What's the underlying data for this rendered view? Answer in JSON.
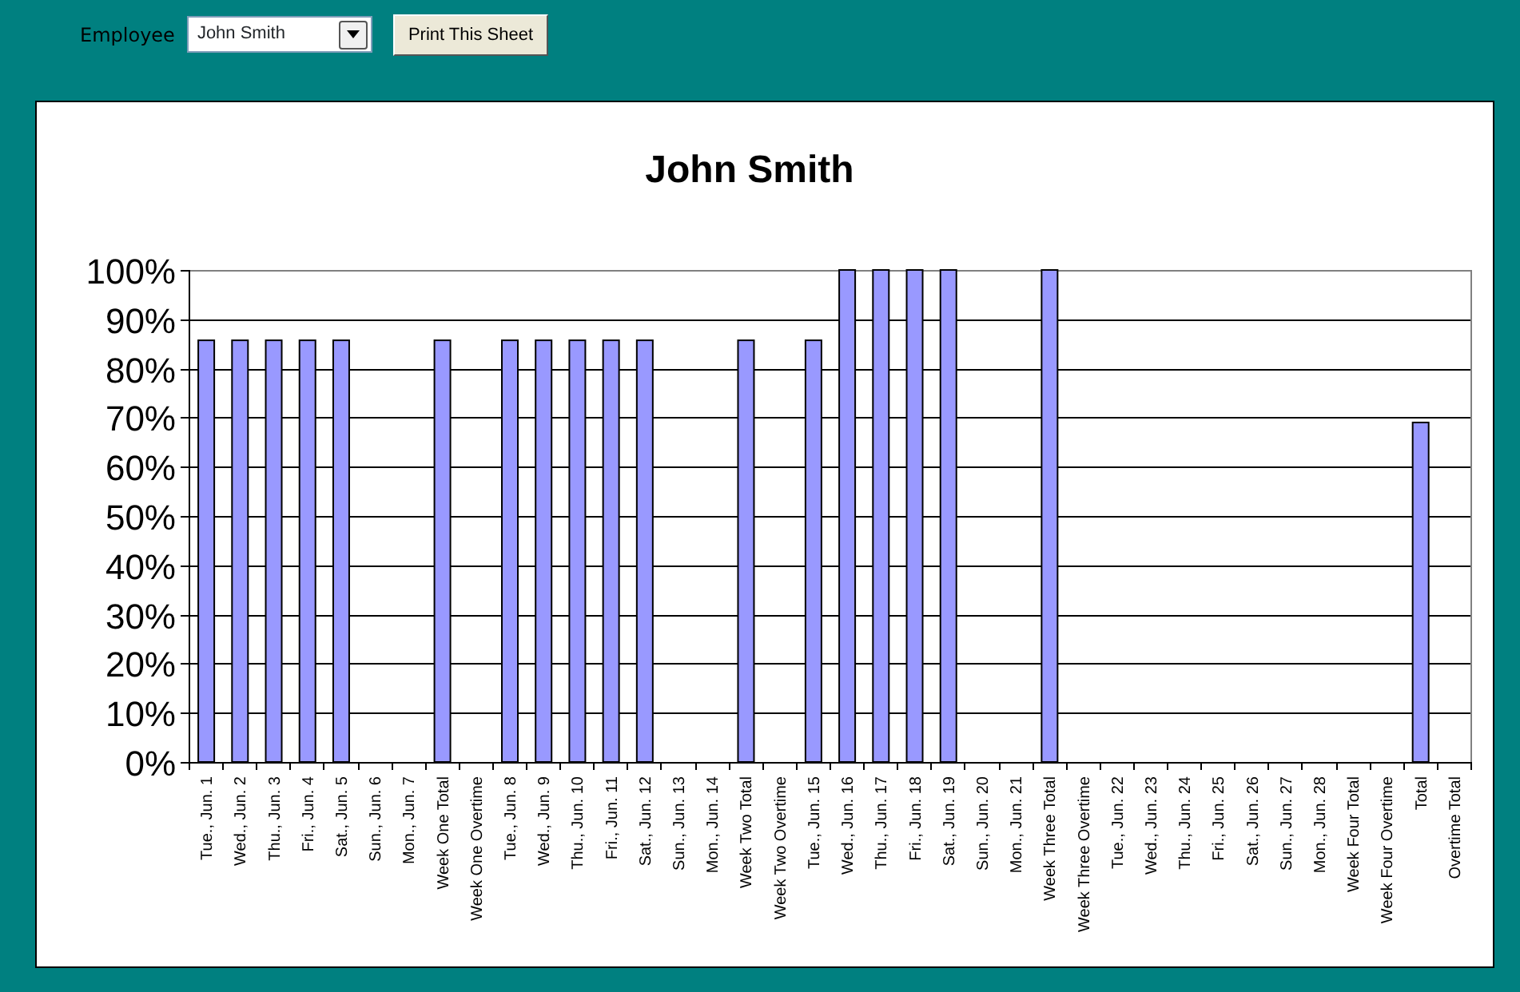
{
  "toolbar": {
    "employee_label": "Employee",
    "employee_value": "John Smith",
    "print_button": "Print This Sheet"
  },
  "chart": {
    "chart_data": {
      "type": "bar",
      "title": "John Smith",
      "categories": [
        "Tue., Jun. 1",
        "Wed., Jun. 2",
        "Thu., Jun. 3",
        "Fri., Jun. 4",
        "Sat., Jun. 5",
        "Sun., Jun. 6",
        "Mon., Jun. 7",
        "Week One Total",
        "Week One Overtime",
        "Tue., Jun. 8",
        "Wed., Jun. 9",
        "Thu., Jun. 10",
        "Fri., Jun. 11",
        "Sat., Jun. 12",
        "Sun., Jun. 13",
        "Mon., Jun. 14",
        "Week Two Total",
        "Week Two Overtime",
        "Tue., Jun. 15",
        "Wed., Jun. 16",
        "Thu., Jun. 17",
        "Fri., Jun. 18",
        "Sat., Jun. 19",
        "Sun., Jun. 20",
        "Mon., Jun. 21",
        "Week Three Total",
        "Week Three Overtime",
        "Tue., Jun. 22",
        "Wed., Jun. 23",
        "Thu., Jun. 24",
        "Fri., Jun. 25",
        "Sat., Jun. 26",
        "Sun., Jun. 27",
        "Mon., Jun. 28",
        "Week Four Total",
        "Week Four Overtime",
        "Total",
        "Overtime Total"
      ],
      "grid": true,
      "series": [
        {
          "color": "#9999ff",
          "values": [
            0.857,
            0.857,
            0.857,
            0.857,
            0.857,
            null,
            null,
            0.857,
            null,
            0.857,
            0.857,
            0.857,
            0.857,
            0.857,
            null,
            null,
            0.857,
            null,
            0.857,
            1,
            1,
            1,
            1,
            null,
            null,
            1,
            null,
            null,
            null,
            null,
            null,
            null,
            null,
            null,
            null,
            null,
            0.69,
            null
          ]
        }
      ],
      "ylim": [
        0,
        1
      ],
      "yticks": [
        {
          "value": 0,
          "label": "0%"
        },
        {
          "value": 0.1,
          "label": "10%"
        },
        {
          "value": 0.2,
          "label": "20%"
        },
        {
          "value": 0.3,
          "label": "30%"
        },
        {
          "value": 0.4,
          "label": "40%"
        },
        {
          "value": 0.5,
          "label": "50%"
        },
        {
          "value": 0.6,
          "label": "60%"
        },
        {
          "value": 0.7,
          "label": "70%"
        },
        {
          "value": 0.8,
          "label": "80%"
        },
        {
          "value": 0.9,
          "label": "90%"
        },
        {
          "value": 1,
          "label": "100%"
        }
      ]
    }
  }
}
